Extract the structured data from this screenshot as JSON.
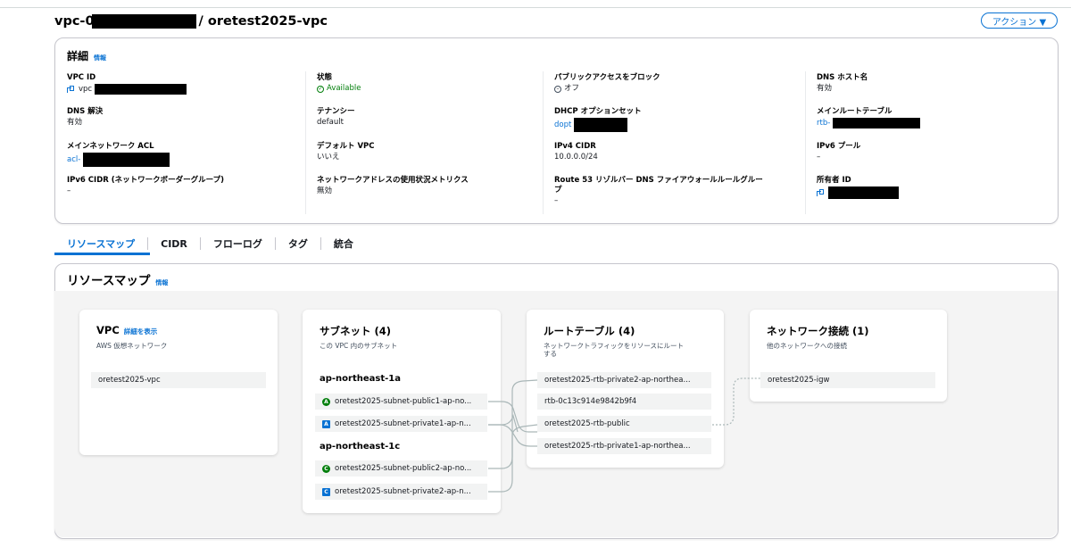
{
  "header": {
    "title_prefix": "vpc-0",
    "title_suffix": "/ oretest2025-vpc",
    "action_label": "アクション ▼"
  },
  "details": {
    "heading": "詳細",
    "info": "情報",
    "fields": {
      "vpc_id": {
        "label": "VPC ID",
        "value": "vpc"
      },
      "state": {
        "label": "状態",
        "value": "Available"
      },
      "block_public": {
        "label": "パブリックアクセスをブロック",
        "value": "オフ"
      },
      "dns_hostnames": {
        "label": "DNS ホスト名",
        "value": "有効"
      },
      "dns_resolution": {
        "label": "DNS 解決",
        "value": "有効"
      },
      "tenancy": {
        "label": "テナンシー",
        "value": "default"
      },
      "dhcp": {
        "label": "DHCP オプションセット",
        "value": "dopt"
      },
      "main_rtb": {
        "label": "メインルートテーブル",
        "value": "rtb-"
      },
      "main_acl": {
        "label": "メインネットワーク ACL",
        "value": "acl-"
      },
      "default_vpc": {
        "label": "デフォルト VPC",
        "value": "いいえ"
      },
      "ipv4_cidr": {
        "label": "IPv4 CIDR",
        "value": "10.0.0.0/24"
      },
      "ipv6_pool": {
        "label": "IPv6 プール",
        "value": "–"
      },
      "ipv6_cidr": {
        "label": "IPv6 CIDR (ネットワークボーダーグループ)",
        "value": "–"
      },
      "addr_usage": {
        "label": "ネットワークアドレスの使用状況メトリクス",
        "value": "無効"
      },
      "r53_line1": "Route 53 リゾルバー DNS ファイアウォールルールグルー",
      "r53_line2": "プ",
      "r53_value": "–",
      "owner": {
        "label": "所有者 ID"
      }
    }
  },
  "tabs": [
    "リソースマップ",
    "CIDR",
    "フローログ",
    "タグ",
    "統合"
  ],
  "resource_map": {
    "heading": "リソースマップ",
    "info": "情報",
    "vpc": {
      "title": "VPC",
      "link": "詳細を表示",
      "subtitle": "AWS 仮想ネットワーク",
      "item": "oretest2025-vpc"
    },
    "subnets": {
      "title": "サブネット (4)",
      "subtitle": "この VPC 内のサブネット",
      "az1": "ap-northeast-1a",
      "az2": "ap-northeast-1c",
      "items": [
        {
          "badge": "A",
          "label": "oretest2025-subnet-public1-ap-no..."
        },
        {
          "badge": "A",
          "label": "oretest2025-subnet-private1-ap-n..."
        },
        {
          "badge": "C",
          "label": "oretest2025-subnet-public2-ap-no..."
        },
        {
          "badge": "C",
          "label": "oretest2025-subnet-private2-ap-n..."
        }
      ]
    },
    "route_tables": {
      "title": "ルートテーブル (4)",
      "subtitle1": "ネットワークトラフィックをリソースにルート",
      "subtitle2": "する",
      "items": [
        "oretest2025-rtb-private2-ap-northea...",
        "rtb-0c13c914e9842b9f4",
        "oretest2025-rtb-public",
        "oretest2025-rtb-private1-ap-northea..."
      ]
    },
    "network": {
      "title": "ネットワーク接続 (1)",
      "subtitle": "他のネットワークへの接続",
      "item": "oretest2025-igw"
    }
  }
}
